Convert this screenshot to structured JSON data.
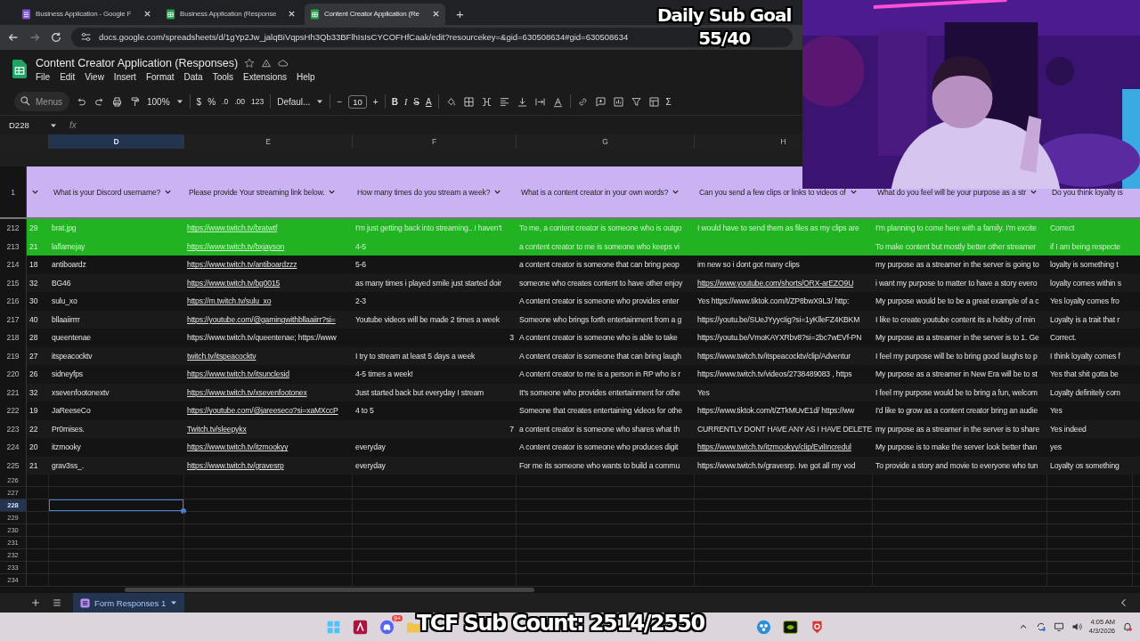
{
  "browser": {
    "tabs": [
      {
        "title": "Business Application - Google F",
        "kind": "forms",
        "selected": false
      },
      {
        "title": "Business Application (Response",
        "kind": "sheets",
        "selected": false
      },
      {
        "title": "Content Creator Application (Re",
        "kind": "sheets",
        "selected": true
      }
    ],
    "new_tab": "+",
    "address": "docs.google.com/spreadsheets/d/1gYp2Jw_jalqBiVqpsHh3Qb33BFlhIsIsCYCOFHfCaak/edit?resourcekey=&gid=630508634#gid=630508634"
  },
  "document": {
    "title": "Content Creator Application (Responses)",
    "menus": [
      "File",
      "Edit",
      "View",
      "Insert",
      "Format",
      "Data",
      "Tools",
      "Extensions",
      "Help"
    ]
  },
  "toolbar": {
    "search_placeholder": "Menus",
    "zoom": "100%",
    "currency": "$",
    "percent": "%",
    "decrease_decimals": ".0",
    "increase_decimals": ".00",
    "number_format": "123",
    "font": "Defaul...",
    "font_minus": "−",
    "font_size": "10",
    "font_plus": "+",
    "bold": "B",
    "italic": "I",
    "strikethrough": "S",
    "text_color": "A",
    "sum": "Σ"
  },
  "formula_bar": {
    "name_box": "D228",
    "fx": "fx"
  },
  "columns": [
    {
      "letter": "D",
      "selected": true
    },
    {
      "letter": "E",
      "selected": false
    },
    {
      "letter": "F",
      "selected": false
    },
    {
      "letter": "G",
      "selected": false
    },
    {
      "letter": "H",
      "selected": false
    }
  ],
  "header_row": {
    "number": "1",
    "headers": [
      "What is your Discord username?",
      "Please provide Your streaming link below.",
      "How many times do you stream a week?",
      "What is a content creator in your own words?",
      "Can you send a few clips or links to videos of",
      "What do you feel will be your purpose as a str",
      "Do you think loyalty is"
    ]
  },
  "rows": [
    {
      "number": "212",
      "highlighted": true,
      "cells": [
        {
          "text": "29",
          "kind": "text"
        },
        {
          "text": "brat.jpg",
          "kind": "text"
        },
        {
          "text": "https://www.twitch.tv/bratwtf",
          "kind": "link"
        },
        {
          "text": "I'm just getting back into streaming.. I haven't",
          "kind": "text"
        },
        {
          "text": "To me, a content creator is someone who is outgo",
          "kind": "text"
        },
        {
          "text": "I would have to send them as files as my clips are",
          "kind": "text"
        },
        {
          "text": "I'm planning to come here with a family. I'm excite",
          "kind": "text"
        },
        {
          "text": "Correct",
          "kind": "text"
        }
      ]
    },
    {
      "number": "213",
      "highlighted": true,
      "cells": [
        {
          "text": "21",
          "kind": "text"
        },
        {
          "text": "laflamejay",
          "kind": "text"
        },
        {
          "text": "https://www.twitch.tv/bxjayson",
          "kind": "link"
        },
        {
          "text": "4-5",
          "kind": "text"
        },
        {
          "text": "a content creator to me is someone who keeps vi",
          "kind": "text"
        },
        {
          "kind": "empty"
        },
        {
          "text": "To make content but mostly better other streamer",
          "kind": "text"
        },
        {
          "text": "if I am being respecte",
          "kind": "text"
        }
      ]
    },
    {
      "number": "214",
      "highlighted": false,
      "cells": [
        {
          "text": "18",
          "kind": "text"
        },
        {
          "text": "antiboardz",
          "kind": "text"
        },
        {
          "text": "https://www.twitch.tv/antiboardzzz",
          "kind": "link"
        },
        {
          "text": "5-6",
          "kind": "text"
        },
        {
          "text": "a content creator is someone that can bring peop",
          "kind": "text"
        },
        {
          "text": "im new so i dont got many clips",
          "kind": "text"
        },
        {
          "text": "my purpose as a streamer in the server is going to",
          "kind": "text"
        },
        {
          "text": "loyalty is something t",
          "kind": "text"
        }
      ]
    },
    {
      "number": "215",
      "highlighted": false,
      "cells": [
        {
          "text": "32",
          "kind": "text"
        },
        {
          "text": "BG46",
          "kind": "text"
        },
        {
          "text": "https://www.twitch.tv/bg0015",
          "kind": "link"
        },
        {
          "text": "as many times i played smile just started doir",
          "kind": "text"
        },
        {
          "text": "someone who creates content to have other enjoy",
          "kind": "text"
        },
        {
          "text": "https://www.youtube.com/shorts/ORX-arEZO9U",
          "kind": "link"
        },
        {
          "text": "i want my purpose to matter to have a story evero",
          "kind": "text"
        },
        {
          "text": "loyalty comes within s",
          "kind": "text"
        }
      ]
    },
    {
      "number": "216",
      "highlighted": false,
      "cells": [
        {
          "text": "30",
          "kind": "text"
        },
        {
          "text": "sulu_xo",
          "kind": "text"
        },
        {
          "text": "https://m.twitch.tv/sulu_xo",
          "kind": "link"
        },
        {
          "text": "2-3",
          "kind": "text"
        },
        {
          "text": "A content creator is someone who provides enter",
          "kind": "text"
        },
        {
          "text": "Yes https://www.tiktok.com/t/ZP8bwX9L3/   http:",
          "kind": "text"
        },
        {
          "text": "My purpose would be to be a great example of a c",
          "kind": "text"
        },
        {
          "text": "Yes loyalty comes fro",
          "kind": "text"
        }
      ]
    },
    {
      "number": "217",
      "highlighted": false,
      "cells": [
        {
          "text": "40",
          "kind": "text"
        },
        {
          "text": "bllaaiirrrr",
          "kind": "text"
        },
        {
          "text": "https://youtube.com/@gamingwithbllaaiirr?si=",
          "kind": "link"
        },
        {
          "text": "Youtube videos will be made 2 times a week",
          "kind": "text"
        },
        {
          "text": "Someone who brings forth entertainment from a g",
          "kind": "text"
        },
        {
          "text": "https://youtu.be/SUeJYyycIig?si=1yKlleFZ4KBKM",
          "kind": "text"
        },
        {
          "text": "I like to create youtube content its a hobby of min",
          "kind": "text"
        },
        {
          "text": "Loyalty is a trait that r",
          "kind": "text"
        }
      ]
    },
    {
      "number": "218",
      "highlighted": false,
      "cells": [
        {
          "text": "28",
          "kind": "text"
        },
        {
          "text": "queentenae",
          "kind": "text"
        },
        {
          "text": "https://www.twitch.tv/queentenae; https://www",
          "kind": "text"
        },
        {
          "text": "3",
          "kind": "number"
        },
        {
          "text": "A content creator is someone who is able to take",
          "kind": "text"
        },
        {
          "text": "https://youtu.be/VmoKAYXRbv8?si=2bc7wEVf-PN",
          "kind": "text"
        },
        {
          "text": "My purpose as a streamer in the server is to 1. Ge",
          "kind": "text"
        },
        {
          "text": "Correct.",
          "kind": "text"
        }
      ]
    },
    {
      "number": "219",
      "highlighted": false,
      "cells": [
        {
          "text": "27",
          "kind": "text"
        },
        {
          "text": "itspeacocktv",
          "kind": "text"
        },
        {
          "text": "twitch.tv/itspeacocktv",
          "kind": "link"
        },
        {
          "text": "I try to stream at least 5 days a week",
          "kind": "text"
        },
        {
          "text": "A content creator is someone that can bring laugh",
          "kind": "text"
        },
        {
          "text": "https://www.twitch.tv/itspeacocktv/clip/Adventur",
          "kind": "text"
        },
        {
          "text": "I feel my purpose will be to bring good laughs to p",
          "kind": "text"
        },
        {
          "text": "I think loyalty comes f",
          "kind": "text"
        }
      ]
    },
    {
      "number": "220",
      "highlighted": false,
      "cells": [
        {
          "text": "26",
          "kind": "text"
        },
        {
          "text": "sidneyfps",
          "kind": "text"
        },
        {
          "text": "https://www.twitch.tv/itsunclesid",
          "kind": "link"
        },
        {
          "text": "4-5 times a week!",
          "kind": "text"
        },
        {
          "text": "A content creator to me is a person in RP who is r",
          "kind": "text"
        },
        {
          "text": "https://www.twitch.tv/videos/2738489083 , https",
          "kind": "text"
        },
        {
          "text": "My purpose as a streamer in New Era will be to st",
          "kind": "text"
        },
        {
          "text": "Yes that shit gotta be",
          "kind": "text"
        }
      ]
    },
    {
      "number": "221",
      "highlighted": false,
      "cells": [
        {
          "text": "32",
          "kind": "text"
        },
        {
          "text": "xsevenfootonextv",
          "kind": "text"
        },
        {
          "text": "https://www.twitch.tv/xsevenfootonex",
          "kind": "link"
        },
        {
          "text": "Just started back but everyday I stream",
          "kind": "text"
        },
        {
          "text": "It's someone who provides entertainment for othe",
          "kind": "text"
        },
        {
          "text": "Yes",
          "kind": "text"
        },
        {
          "text": "I feel my purpose would be to bring a fun, welcom",
          "kind": "text"
        },
        {
          "text": "Loyalty definitely com",
          "kind": "text"
        }
      ]
    },
    {
      "number": "222",
      "highlighted": false,
      "cells": [
        {
          "text": "19",
          "kind": "text"
        },
        {
          "text": "JaReeseCo",
          "kind": "text"
        },
        {
          "text": "https://youtube.com/@jareeseco?si=xaMXccP",
          "kind": "link"
        },
        {
          "text": "4 to 5",
          "kind": "text"
        },
        {
          "text": "Someone that creates entertaining videos for othe",
          "kind": "text"
        },
        {
          "text": "https://www.tiktok.com/t/ZTkMUvE1d/ https://ww",
          "kind": "text"
        },
        {
          "text": "I'd like to grow as a content creator bring an audie",
          "kind": "text"
        },
        {
          "text": "Yes",
          "kind": "text"
        }
      ]
    },
    {
      "number": "223",
      "highlighted": false,
      "cells": [
        {
          "text": "22",
          "kind": "text"
        },
        {
          "text": "Pr0mises.",
          "kind": "text"
        },
        {
          "text": "Twitch.tv/sleepykx",
          "kind": "link"
        },
        {
          "text": "7",
          "kind": "number"
        },
        {
          "text": "a content creator is someone who shares what th",
          "kind": "text"
        },
        {
          "text": "CURRENTLY DONT HAVE ANY AS I HAVE DELETE",
          "kind": "text"
        },
        {
          "text": "my purpose as a streamer in the server is to share",
          "kind": "text"
        },
        {
          "text": "Yes indeed",
          "kind": "text"
        }
      ]
    },
    {
      "number": "224",
      "highlighted": false,
      "cells": [
        {
          "text": "20",
          "kind": "text"
        },
        {
          "text": "itzmooky",
          "kind": "text"
        },
        {
          "text": "https://www.twitch.tv/itzmookyy",
          "kind": "link"
        },
        {
          "text": "everyday",
          "kind": "text"
        },
        {
          "text": "A content creator is someone who produces digit",
          "kind": "text"
        },
        {
          "text": "https://www.twitch.tv/itzmookyy/clip/EvilIncredul",
          "kind": "link"
        },
        {
          "text": "My purpose is to make the server look better than",
          "kind": "text"
        },
        {
          "text": "yes",
          "kind": "text"
        }
      ]
    },
    {
      "number": "225",
      "highlighted": false,
      "cells": [
        {
          "text": "21",
          "kind": "text"
        },
        {
          "text": "grav3ss_.",
          "kind": "text"
        },
        {
          "text": "https://www.twitch.tv/gravesrp",
          "kind": "link"
        },
        {
          "text": "everyday",
          "kind": "text"
        },
        {
          "text": "For me its someone who wants to build a commu",
          "kind": "text"
        },
        {
          "text": "https://www.twitch.tv/gravesrp. Ive got all my vod",
          "kind": "text"
        },
        {
          "text": "To provide a story and movie to everyone who tun",
          "kind": "text"
        },
        {
          "text": "Loyalty os something",
          "kind": "text"
        }
      ]
    }
  ],
  "empty_rows": [
    {
      "number": "226",
      "selected": false
    },
    {
      "number": "227",
      "selected": false
    },
    {
      "number": "228",
      "selected": true
    },
    {
      "number": "229",
      "selected": false
    },
    {
      "number": "230",
      "selected": false
    },
    {
      "number": "231",
      "selected": false
    },
    {
      "number": "232",
      "selected": false
    },
    {
      "number": "233",
      "selected": false
    },
    {
      "number": "234",
      "selected": false
    }
  ],
  "sheet_tabs": [
    {
      "name": "Form Responses 1",
      "selected": true
    }
  ],
  "taskbar": {
    "discord_badge": "9+",
    "time": "4:05 AM",
    "date": "4/3/2026"
  },
  "overlays": {
    "goal_title": "Daily Sub Goal",
    "goal_count": "55/40",
    "sub_count": "TCF Sub Count: 2514/2550"
  }
}
